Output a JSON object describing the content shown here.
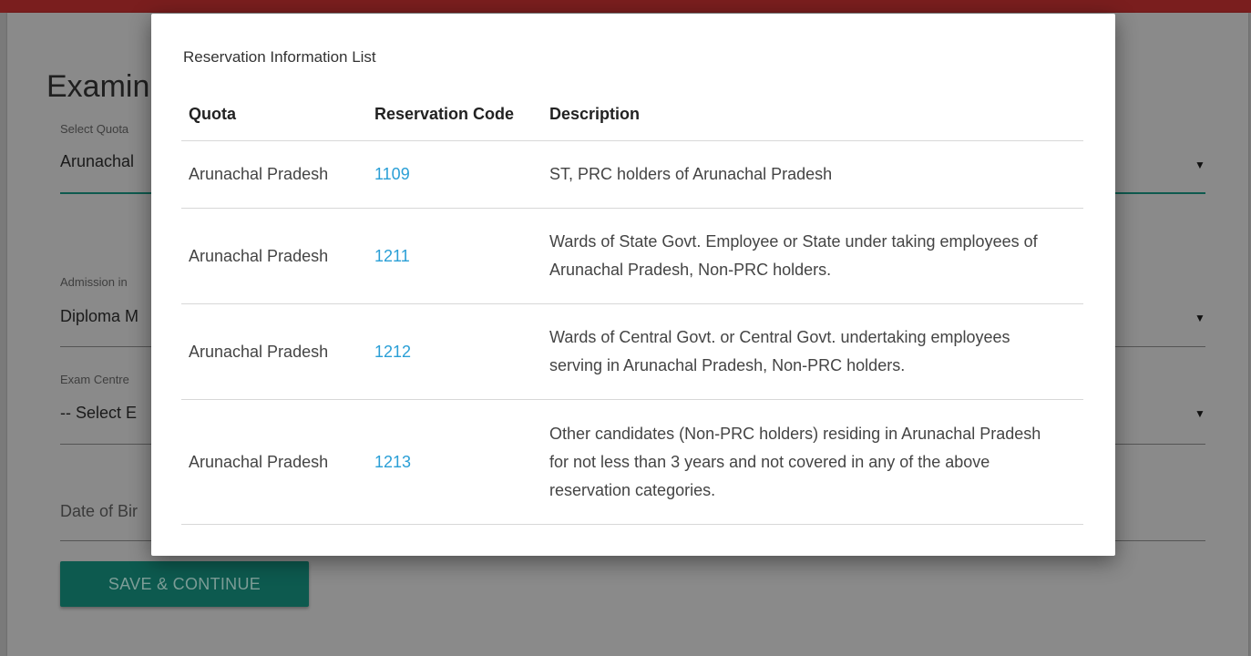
{
  "page": {
    "title": "Examin",
    "fields": [
      {
        "label": "Select Quota",
        "value": "Arunachal"
      },
      {
        "label": "Admission in",
        "value": "Diploma M"
      },
      {
        "label": "Exam Centre",
        "value": "-- Select E"
      }
    ],
    "date_of_birth_placeholder": "Date of Bir",
    "dropdown_arrow": "▼",
    "save_button_label": "SAVE & CONTINUE"
  },
  "modal": {
    "title": "Reservation Information List",
    "columns": {
      "quota": "Quota",
      "code": "Reservation Code",
      "description": "Description"
    },
    "rows": [
      {
        "quota": "Arunachal Pradesh",
        "code": "1109",
        "description": "ST, PRC holders of Arunachal Pradesh"
      },
      {
        "quota": "Arunachal Pradesh",
        "code": "1211",
        "description": "Wards of State Govt. Employee or State under taking employees of Arunachal Pradesh, Non-PRC holders."
      },
      {
        "quota": "Arunachal Pradesh",
        "code": "1212",
        "description": "Wards of Central Govt. or Central Govt. undertaking employees serving in Arunachal Pradesh, Non-PRC holders."
      },
      {
        "quota": "Arunachal Pradesh",
        "code": "1213",
        "description": "Other candidates (Non-PRC holders) residing in Arunachal Pradesh for not less than 3 years and not covered in any of the above reservation categories."
      }
    ]
  },
  "colors": {
    "top_bar": "#7a1e1e",
    "accent": "#0d5a4f",
    "link": "#2a9fd6"
  }
}
